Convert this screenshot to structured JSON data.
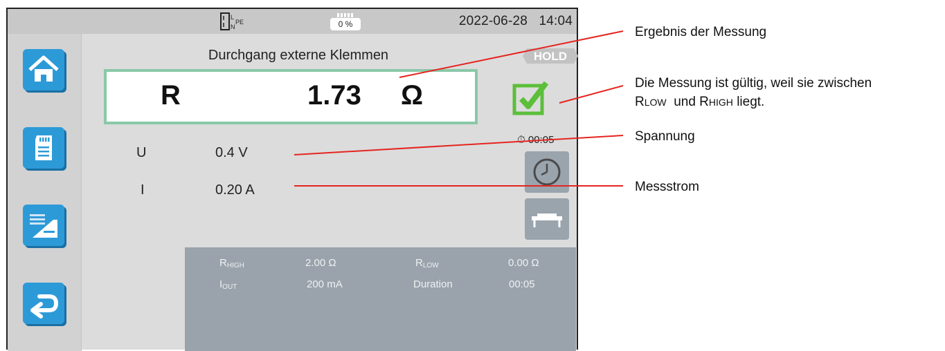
{
  "header": {
    "plug_label_top": "L",
    "plug_label_bottom": "N",
    "plug_label_pe": "PE",
    "battery_percent": "0 %",
    "date": "2022-06-28",
    "time": "14:04"
  },
  "sidebar": {
    "items": [
      {
        "name": "home",
        "icon": "home-icon"
      },
      {
        "name": "memory",
        "icon": "sd-card-icon"
      },
      {
        "name": "config",
        "icon": "settings-list-icon"
      },
      {
        "name": "back",
        "icon": "back-arrow-icon"
      }
    ]
  },
  "measurement": {
    "title": "Durchgang externe Klemmen",
    "hold_label": "HOLD",
    "result_symbol": "R",
    "result_value": "1.73",
    "result_unit": "Ω",
    "u_label": "U",
    "u_value": "0.4 V",
    "i_label": "I",
    "i_value": "0.20 A",
    "timer": "00:05"
  },
  "info_panel": {
    "rhigh_label": "R",
    "rhigh_sub": "HIGH",
    "rhigh_value": "2.00 Ω",
    "rlow_label": "R",
    "rlow_sub": "LOW",
    "rlow_value": "0.00 Ω",
    "iout_label": "I",
    "iout_sub": "OUT",
    "iout_value": "200 mA",
    "duration_label": "Duration",
    "duration_value": "00:05"
  },
  "annotations": {
    "result": "Ergebnis der Messung",
    "valid_line1": "Die Messung ist gültig, weil sie zwischen",
    "valid_rlow_r": "R",
    "valid_rlow_rest": "LOW",
    "valid_and": "und",
    "valid_rhigh_r": "R",
    "valid_rhigh_rest": "HIGH",
    "valid_end": "liegt.",
    "voltage": "Spannung",
    "current": "Messstrom"
  },
  "colors": {
    "accent_blue": "#2d9ad8",
    "valid_green": "#5cbf3a",
    "result_border": "#8ac8a8",
    "annotation_line": "#e52420"
  }
}
